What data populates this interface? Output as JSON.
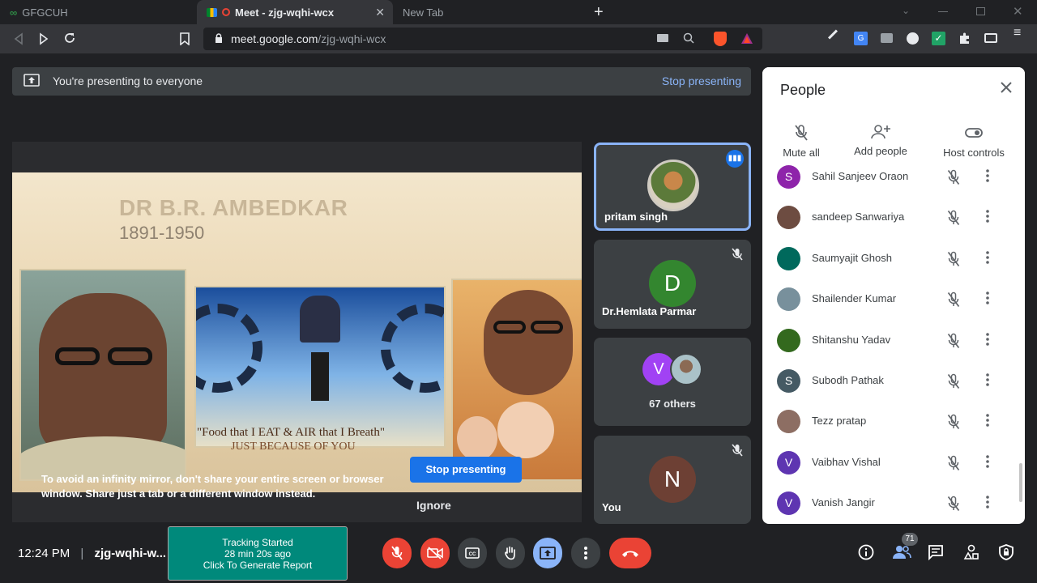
{
  "browser": {
    "tabs": [
      {
        "title": "GFGCUH"
      },
      {
        "title": "Meet - zjg-wqhi-wcx"
      },
      {
        "title": "New Tab"
      }
    ],
    "url_host": "meet.google.com",
    "url_path": "/zjg-wqhi-wcx"
  },
  "presenting_bar": {
    "text": "You're presenting to everyone",
    "stop_label": "Stop presenting"
  },
  "slide": {
    "title": "DR B.R. AMBEDKAR",
    "years": "1891-1950",
    "quote_line1": "\"Food that I EAT & AIR that I Breath\"",
    "quote_line2": "JUST BECAUSE OF YOU"
  },
  "mirror_warning": {
    "text": "To avoid an infinity mirror, don't share your entire screen or browser window. Share just a tab or a different window instead.",
    "stop_label": "Stop presenting",
    "ignore_label": "Ignore"
  },
  "tiles": [
    {
      "name": "pritam singh"
    },
    {
      "name": "Dr.Hemlata Parmar",
      "initial": "D"
    },
    {
      "name": "67 others",
      "initial": "V"
    },
    {
      "name": "You",
      "initial": "N"
    }
  ],
  "people_panel": {
    "title": "People",
    "actions": [
      {
        "label": "Mute all"
      },
      {
        "label": "Add people"
      },
      {
        "label": "Host controls"
      }
    ],
    "people": [
      {
        "name": "Sahil Sanjeev Oraon",
        "initial": "S",
        "color": "#8e24aa"
      },
      {
        "name": "sandeep Sanwariya",
        "initial": "",
        "color": "#6d4c41"
      },
      {
        "name": "Saumyajit Ghosh",
        "initial": "",
        "color": "#00695c"
      },
      {
        "name": "Shailender Kumar",
        "initial": "",
        "color": "#78909c"
      },
      {
        "name": "Shitanshu Yadav",
        "initial": "",
        "color": "#33691e"
      },
      {
        "name": "Subodh Pathak",
        "initial": "S",
        "color": "#455a64"
      },
      {
        "name": "Tezz pratap",
        "initial": "",
        "color": "#8d6e63"
      },
      {
        "name": "Vaibhav Vishal",
        "initial": "V",
        "color": "#5e35b1"
      },
      {
        "name": "Vanish Jangir",
        "initial": "V",
        "color": "#5e35b1"
      }
    ]
  },
  "bottom": {
    "time": "12:24 PM",
    "meeting_code": "zjg-wqhi-w...",
    "tracking_line1": "Tracking Started",
    "tracking_line2": "28 min 20s ago",
    "tracking_line3": "Click To Generate Report",
    "participants_count": "71"
  }
}
